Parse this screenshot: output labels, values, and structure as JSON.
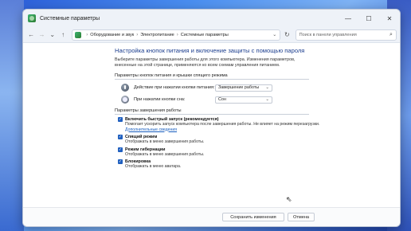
{
  "window": {
    "title": "Системные параметры",
    "controls": {
      "minimize": "—",
      "maximize": "☐",
      "close": "✕"
    }
  },
  "nav": {
    "back": "←",
    "forward": "→",
    "dropdown": "⌄",
    "up": "↑",
    "breadcrumb": [
      "Оборудование и звук",
      "Электропитание",
      "Системные параметры"
    ],
    "breadcrumb_sep": "›",
    "refresh": "↻",
    "search_placeholder": "Поиск в панели управления"
  },
  "main": {
    "heading": "Настройка кнопок питания и включение защиты с помощью пароля",
    "description": "Выберите параметры завершения работы для этого компьютера. Изменения параметров, внесенные на этой странице, применяются ко всем схемам управления питанием.",
    "power_section_title": "Параметры кнопок питания и крышки спящего режима",
    "power_rows": [
      {
        "label": "Действие при нажатии кнопки питания:",
        "value": "Завершение работы",
        "icon": "power-icon"
      },
      {
        "label": "При нажатии кнопки сна:",
        "value": "Сон",
        "icon": "sleep-icon"
      }
    ],
    "shutdown_section_title": "Параметры завершения работы",
    "checkboxes": [
      {
        "label": "Включить быстрый запуск (рекомендуется)",
        "desc": "Помогает ускорить запуск компьютера после завершения работы. Не влияет на режим перезагрузки.",
        "link": "Дополнительные сведения",
        "checked": true
      },
      {
        "label": "Спящий режим",
        "desc": "Отображать в меню завершения работы.",
        "checked": true
      },
      {
        "label": "Режим гибернации",
        "desc": "Отображать в меню завершения работы.",
        "checked": true
      },
      {
        "label": "Блокировка",
        "desc": "Отображать в меню аватара.",
        "checked": true
      }
    ]
  },
  "footer": {
    "save_label": "Сохранить изменения",
    "cancel_label": "Отмена"
  },
  "colors": {
    "heading": "#1d3f8f",
    "link": "#1a5fbf",
    "checkbox": "#1f5fbf"
  }
}
